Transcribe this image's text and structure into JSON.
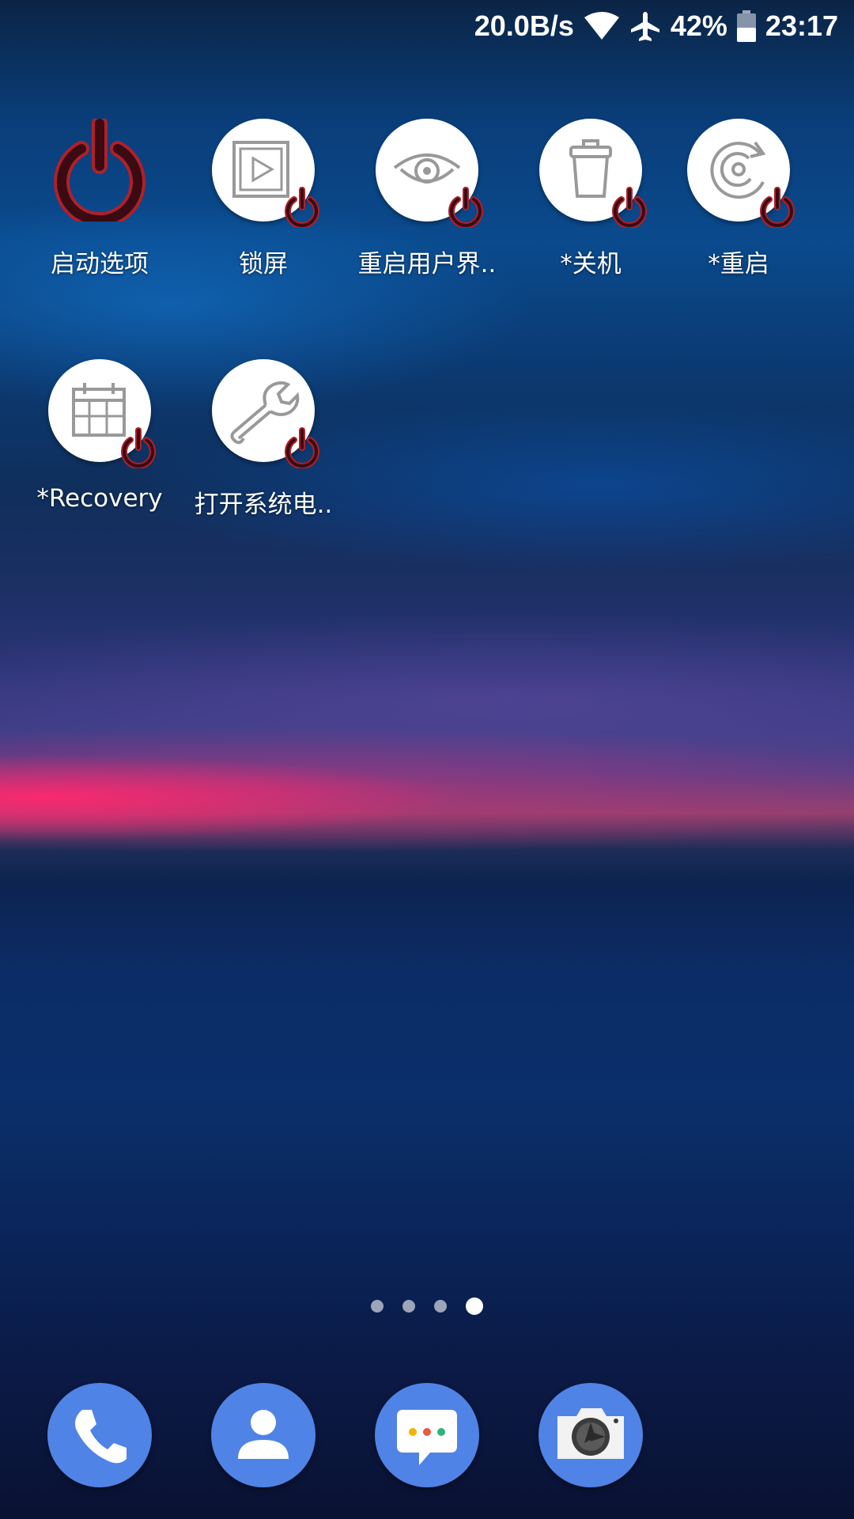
{
  "status_bar": {
    "net_speed": "20.0B/s",
    "battery": "42%",
    "time": "23:17",
    "icons": [
      "wifi-icon",
      "airplane-mode-icon",
      "battery-icon"
    ]
  },
  "apps": [
    {
      "label": "启动选项",
      "icon": "power-icon"
    },
    {
      "label": "锁屏",
      "icon": "lock-screen-icon"
    },
    {
      "label": "重启用户界..",
      "icon": "eye-icon"
    },
    {
      "label": "*关机",
      "icon": "trash-icon"
    },
    {
      "label": "*重启",
      "icon": "restart-icon"
    },
    {
      "label": "*Recovery",
      "icon": "grid-calendar-icon"
    },
    {
      "label": "打开系统电..",
      "icon": "wrench-icon"
    }
  ],
  "page_indicator": {
    "total": 4,
    "current": 4
  },
  "dock": [
    {
      "icon": "phone-icon"
    },
    {
      "icon": "contacts-icon"
    },
    {
      "icon": "messages-icon"
    },
    {
      "icon": "camera-icon"
    }
  ],
  "colors": {
    "dock_blue": "#4f83e6",
    "power_red": "#b0202a",
    "power_dark": "#3a0b12"
  }
}
